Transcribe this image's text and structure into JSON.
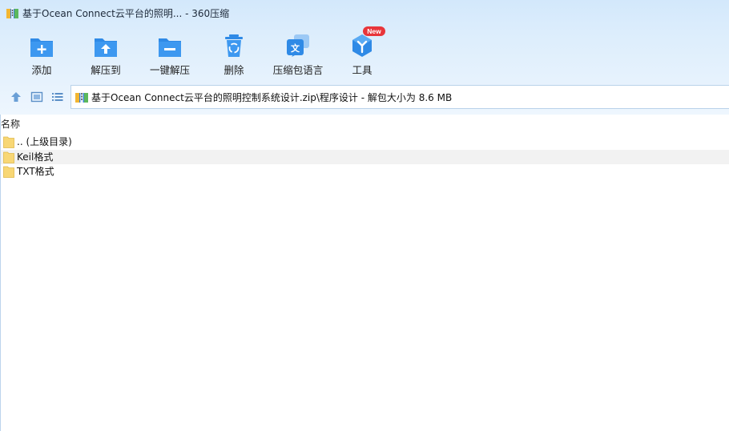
{
  "window": {
    "title": "基于Ocean Connect云平台的照明... - 360压缩"
  },
  "toolbar": {
    "add": "添加",
    "extract_to": "解压到",
    "one_click_extract": "一键解压",
    "delete": "删除",
    "archive_language": "压缩包语言",
    "tools": "工具",
    "tools_badge": "New"
  },
  "address": {
    "path": "基于Ocean Connect云平台的照明控制系统设计.zip\\程序设计 - 解包大小为 8.6 MB"
  },
  "file_list": {
    "column_name": "名称",
    "items": [
      {
        "name": ".. (上级目录)"
      },
      {
        "name": "Keil格式"
      },
      {
        "name": "TXT格式"
      }
    ]
  },
  "colors": {
    "accent_blue": "#2f8ae6",
    "folder_yellow": "#f8d775",
    "badge_red": "#e8353a"
  }
}
